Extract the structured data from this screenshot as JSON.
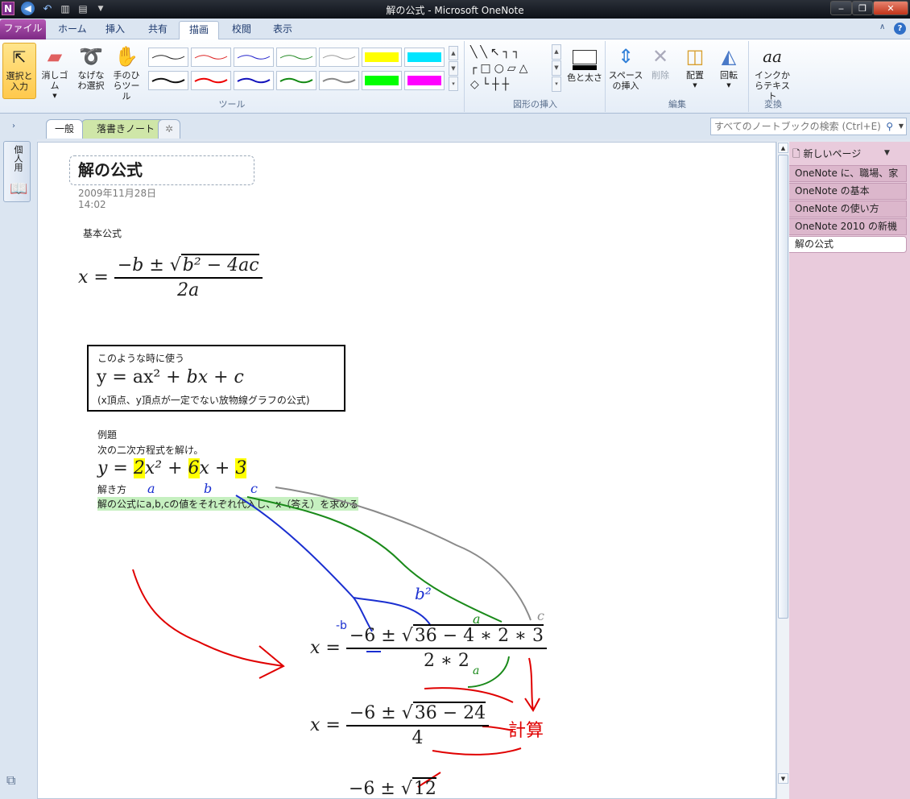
{
  "window": {
    "title": "解の公式 - Microsoft OneNote",
    "logo_letter": "N"
  },
  "ribbon_tabs": {
    "file": "ファイル",
    "home": "ホーム",
    "insert": "挿入",
    "share": "共有",
    "draw": "描画",
    "review": "校閲",
    "view": "表示"
  },
  "ribbon": {
    "select_input": "選択と入力",
    "eraser": "消しゴム",
    "lasso": "なげなわ選択",
    "pan": "手のひらツール",
    "tools_group": "ツール",
    "color_thickness": "色と太さ",
    "shapes_group": "図形の挿入",
    "insert_space": "スペースの挿入",
    "delete": "削除",
    "arrange": "配置",
    "rotate": "回転",
    "edit_group": "編集",
    "ink_to_text": "インクからテキスト",
    "convert_group": "変換"
  },
  "sections": {
    "general": "一般",
    "doodle": "落書きノート"
  },
  "search": {
    "placeholder": "すべてのノートブックの検索 (Ctrl+E)"
  },
  "notebook": {
    "name": "個人用"
  },
  "page": {
    "title": "解の公式",
    "date": "2009年11月28日",
    "time": "14:02",
    "basic_formula_label": "基本公式",
    "when_to_use": "このような時に使う",
    "parabola_note": "(x頂点、y頂点が一定でない放物線グラフの公式)",
    "example_label": "例題",
    "problem": "次の二次方程式を解け。",
    "how_to_label": "解き方",
    "instruction": "解の公式にa,b,cの値をそれぞれ代入し、x（答え）を求める",
    "ink_a": "a",
    "ink_b": "b",
    "ink_c": "c",
    "ink_b2": "b²",
    "ink_minus_b": "-b",
    "ink_calc": "計算"
  },
  "page_list": {
    "new_page": "新しいページ",
    "items": [
      "OneNote に、職場、家",
      "OneNote の基本",
      "OneNote の使い方",
      "OneNote 2010 の新機",
      "解の公式"
    ]
  },
  "colors": {
    "file_tab": "#9b3fa0",
    "page_list_bg": "#e9cbdc",
    "doodle_tab": "#cfe6a8",
    "ink_red": "#e00000",
    "ink_blue": "#1a2fd0",
    "ink_green": "#1a8a1a",
    "ink_gray": "#8a8a8a"
  }
}
